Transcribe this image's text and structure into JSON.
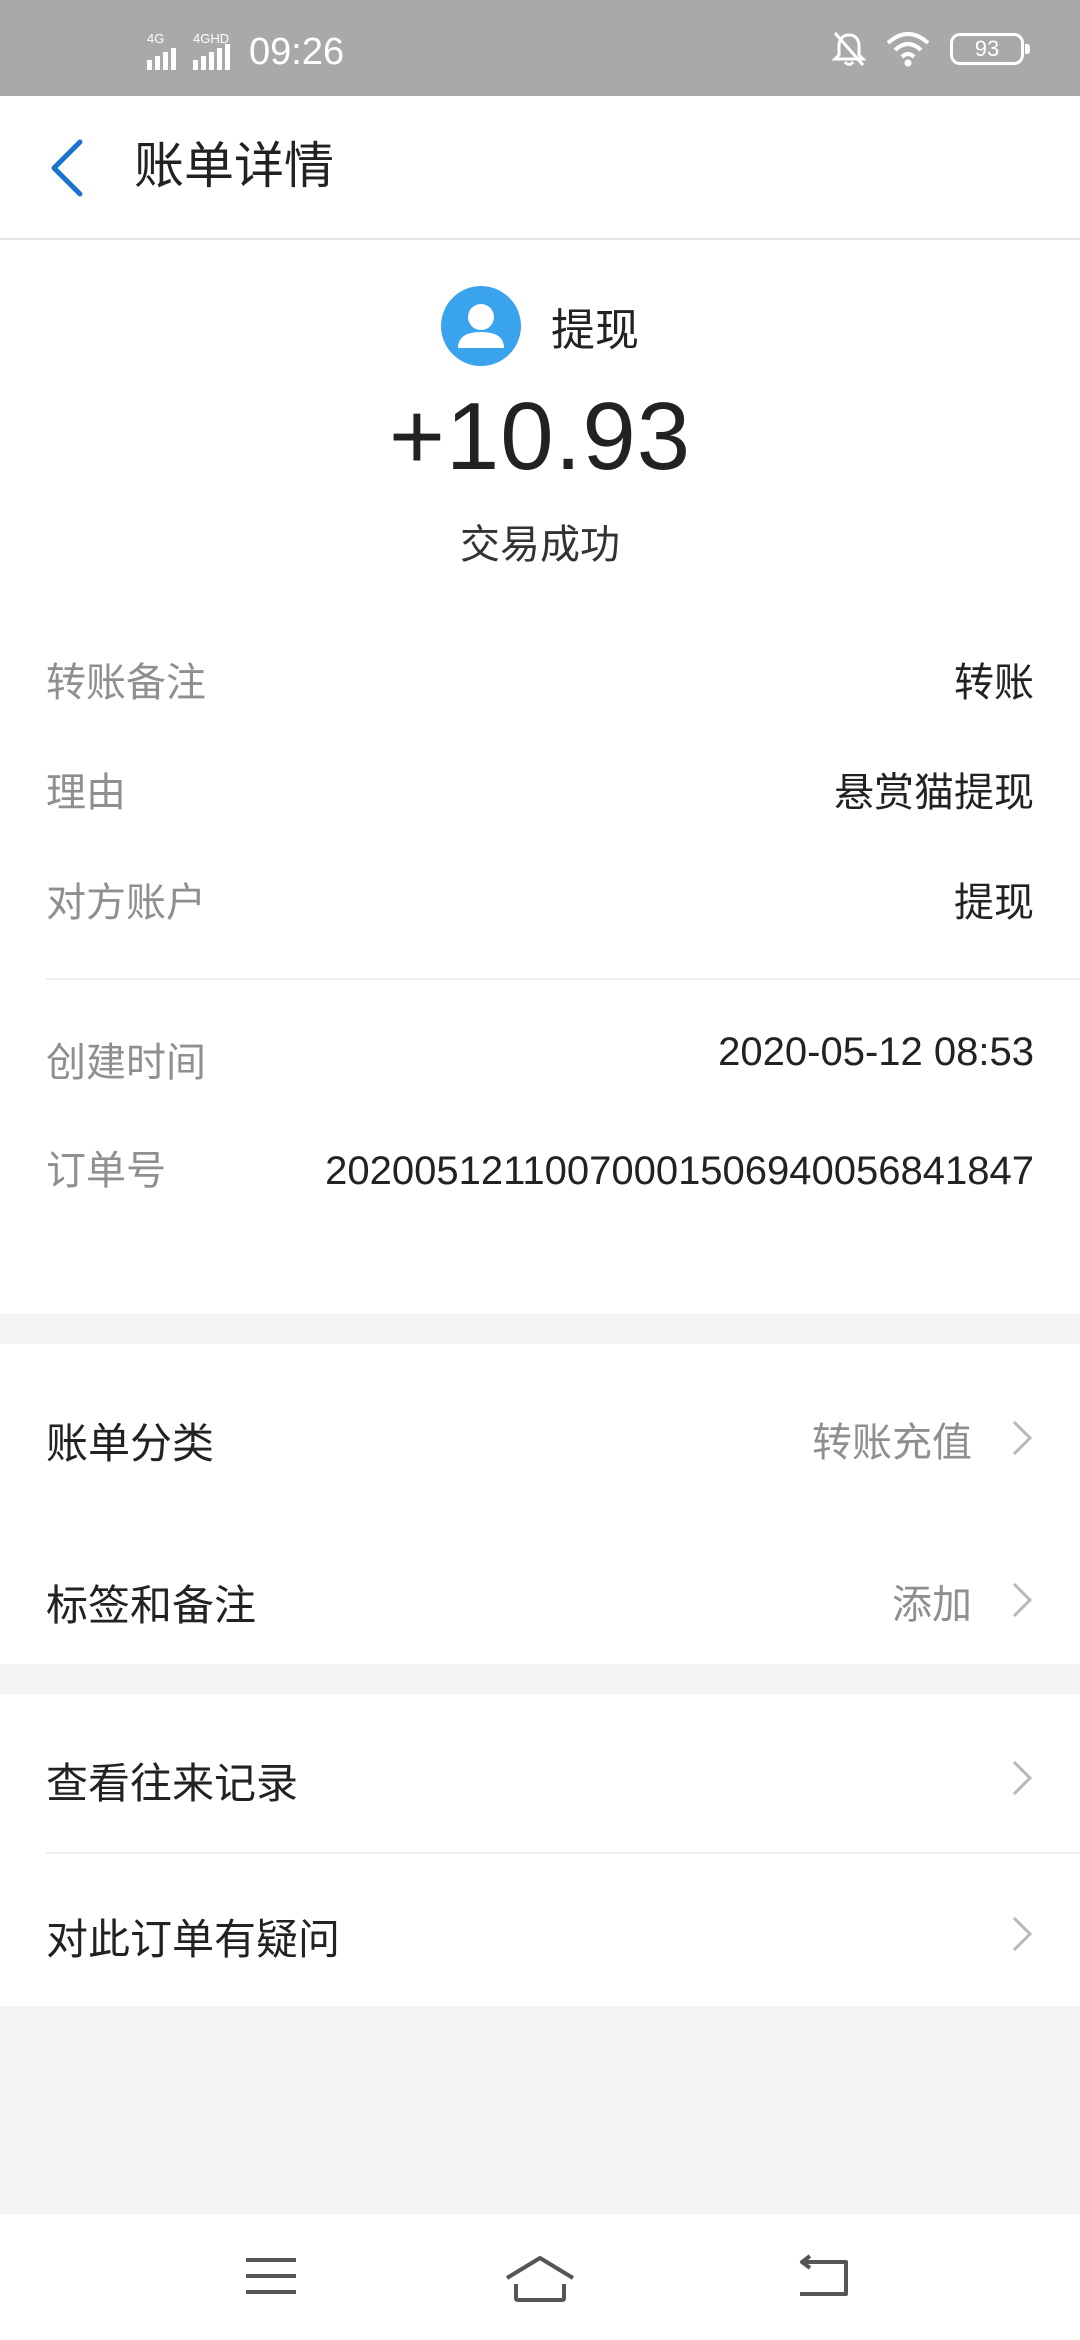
{
  "status_bar": {
    "network_1": "4G",
    "network_2": "4GHD",
    "time": "09:26",
    "battery": "93"
  },
  "nav": {
    "title": "账单详情"
  },
  "transaction": {
    "counterparty": "提现",
    "amount": "+10.93",
    "status": "交易成功"
  },
  "details": [
    {
      "label": "转账备注",
      "value": "转账"
    },
    {
      "label": "理由",
      "value": "悬赏猫提现"
    },
    {
      "label": "对方账户",
      "value": "提现"
    }
  ],
  "meta": {
    "created_label": "创建时间",
    "created_value": "2020-05-12 08:53",
    "order_label": "订单号",
    "order_value": "20200512110070001506940056841847"
  },
  "category_items": [
    {
      "label": "账单分类",
      "value": "转账充值"
    },
    {
      "label": "标签和备注",
      "value": "添加"
    }
  ],
  "record_items": [
    {
      "label": "查看往来记录"
    },
    {
      "label": "对此订单有疑问"
    }
  ],
  "colors": {
    "accent": "#3aa3ee",
    "back_arrow": "#1a73d1",
    "status_bar": "#a9a9a9"
  }
}
